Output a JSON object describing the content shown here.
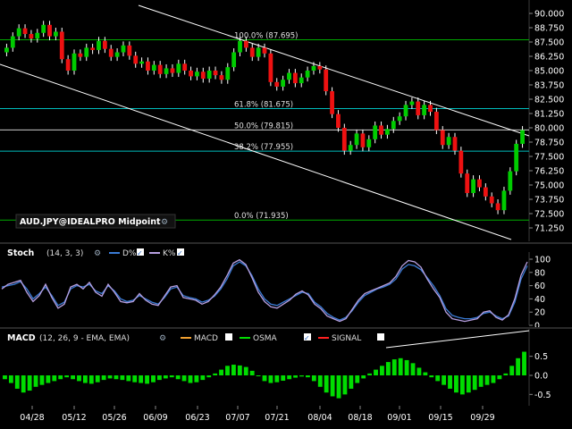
{
  "chart_data": [
    {
      "type": "candlestick",
      "symbol_label": "AUD.JPY@IDEALPRO Midpoint",
      "y_ticks": [
        "90.000",
        "88.750",
        "87.500",
        "86.250",
        "85.000",
        "83.750",
        "82.500",
        "81.250",
        "80.000",
        "78.750",
        "77.500",
        "76.250",
        "75.000",
        "73.750",
        "72.500",
        "71.250"
      ],
      "ylim": [
        71.25,
        90.0
      ],
      "x_ticks": [
        "04/28",
        "05/12",
        "05/26",
        "06/09",
        "06/23",
        "07/07",
        "07/21",
        "08/04",
        "08/18",
        "09/01",
        "09/15",
        "09/29"
      ],
      "fibonacci": [
        {
          "label": "100.0% (87.695)",
          "value": 87.695
        },
        {
          "label": "61.8% (81.675)",
          "value": 81.675
        },
        {
          "label": "50.0% (79.815)",
          "value": 79.815
        },
        {
          "label": "38.2% (77.955)",
          "value": 77.955
        },
        {
          "label": "0.0% (71.935)",
          "value": 71.935
        }
      ],
      "closes": [
        87.0,
        88.0,
        88.7,
        88.2,
        87.8,
        88.3,
        89.0,
        88.0,
        88.4,
        86.0,
        85.0,
        86.5,
        86.2,
        87.0,
        86.8,
        87.6,
        86.9,
        86.2,
        86.6,
        87.2,
        86.3,
        85.6,
        85.8,
        85.0,
        85.5,
        84.7,
        85.2,
        84.8,
        85.6,
        85.0,
        84.5,
        84.9,
        84.3,
        85.0,
        84.6,
        84.2,
        85.3,
        86.6,
        87.6,
        87.0,
        86.2,
        87.0,
        86.5,
        84.0,
        83.6,
        84.2,
        84.8,
        83.9,
        84.4,
        85.0,
        85.4,
        85.1,
        83.2,
        81.2,
        80.0,
        78.0,
        78.5,
        79.5,
        78.3,
        79.0,
        80.2,
        79.4,
        79.9,
        80.6,
        81.0,
        82.0,
        82.3,
        81.1,
        82.0,
        81.4,
        79.8,
        78.5,
        79.2,
        78.0,
        76.0,
        74.3,
        75.5,
        74.8,
        74.0,
        73.4,
        72.8,
        74.5,
        76.2,
        78.6,
        79.8
      ],
      "volume_indicator": "Stoch"
    },
    {
      "type": "line",
      "title": "Stoch",
      "params": "(14, 3, 3)",
      "legend": [
        "D%",
        "K%"
      ],
      "colors": {
        "d": "#3a7bd5",
        "k": "#b79fe0"
      },
      "y_ticks": [
        "100",
        "80",
        "60",
        "40",
        "20",
        "0"
      ],
      "ylim": [
        0,
        100
      ],
      "series": [
        {
          "name": "D%",
          "values": [
            58,
            60,
            62,
            66,
            55,
            40,
            48,
            58,
            45,
            30,
            35,
            55,
            60,
            58,
            62,
            52,
            48,
            60,
            52,
            40,
            36,
            38,
            45,
            40,
            35,
            32,
            42,
            55,
            58,
            45,
            42,
            40,
            35,
            38,
            44,
            55,
            70,
            90,
            96,
            90,
            75,
            55,
            40,
            32,
            30,
            35,
            40,
            45,
            50,
            48,
            35,
            28,
            18,
            12,
            8,
            12,
            22,
            35,
            45,
            50,
            55,
            58,
            62,
            70,
            85,
            92,
            90,
            84,
            72,
            60,
            45,
            25,
            15,
            12,
            10,
            10,
            12,
            18,
            20,
            14,
            10,
            14,
            35,
            70,
            90
          ]
        },
        {
          "name": "K%",
          "values": [
            55,
            62,
            65,
            68,
            50,
            36,
            45,
            62,
            42,
            26,
            32,
            58,
            62,
            55,
            65,
            50,
            44,
            62,
            50,
            36,
            34,
            36,
            48,
            38,
            32,
            30,
            44,
            58,
            60,
            42,
            40,
            38,
            32,
            36,
            46,
            58,
            75,
            94,
            99,
            92,
            72,
            50,
            36,
            28,
            26,
            32,
            38,
            47,
            52,
            46,
            32,
            25,
            14,
            10,
            6,
            10,
            24,
            38,
            48,
            52,
            56,
            60,
            64,
            74,
            90,
            98,
            96,
            88,
            70,
            55,
            42,
            20,
            10,
            8,
            6,
            8,
            10,
            20,
            22,
            12,
            8,
            16,
            40,
            76,
            96
          ]
        }
      ]
    },
    {
      "type": "bar",
      "title": "MACD",
      "params": "(12, 26, 9 - EMA, EMA)",
      "legend": [
        "MACD",
        "OSMA",
        "SIGNAL"
      ],
      "colors": {
        "macd": "#f0a030",
        "osma": "#00dd00",
        "signal": "#ff2020"
      },
      "y_ticks": [
        "0.5",
        "0.0",
        "-0.5"
      ],
      "ylim": [
        -0.75,
        0.75
      ],
      "osma": [
        -0.1,
        -0.2,
        -0.35,
        -0.45,
        -0.4,
        -0.3,
        -0.25,
        -0.2,
        -0.15,
        -0.1,
        -0.05,
        -0.1,
        -0.15,
        -0.2,
        -0.22,
        -0.18,
        -0.12,
        -0.08,
        -0.1,
        -0.12,
        -0.15,
        -0.18,
        -0.2,
        -0.22,
        -0.18,
        -0.12,
        -0.08,
        -0.05,
        -0.1,
        -0.15,
        -0.2,
        -0.18,
        -0.12,
        -0.05,
        0.05,
        0.15,
        0.25,
        0.28,
        0.26,
        0.22,
        0.12,
        -0.02,
        -0.15,
        -0.2,
        -0.18,
        -0.14,
        -0.1,
        -0.06,
        -0.03,
        -0.05,
        -0.15,
        -0.3,
        -0.45,
        -0.55,
        -0.6,
        -0.5,
        -0.35,
        -0.2,
        -0.08,
        0.05,
        0.15,
        0.25,
        0.35,
        0.42,
        0.45,
        0.4,
        0.32,
        0.2,
        0.08,
        -0.05,
        -0.15,
        -0.25,
        -0.35,
        -0.45,
        -0.5,
        -0.45,
        -0.38,
        -0.3,
        -0.25,
        -0.2,
        -0.1,
        0.05,
        0.25,
        0.45,
        0.62
      ],
      "annotations": [
        "rising trendline over OSMA highs"
      ]
    }
  ]
}
